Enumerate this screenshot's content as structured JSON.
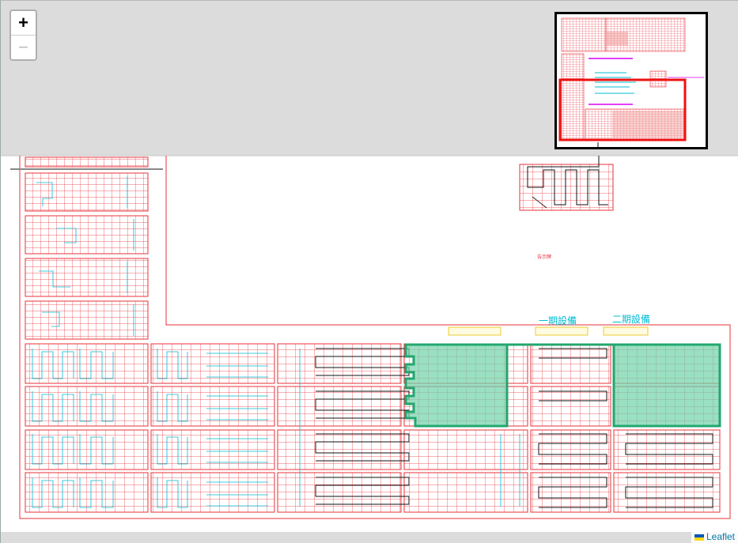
{
  "zoom": {
    "in_label": "+",
    "out_label": "−"
  },
  "attribution": {
    "label": "Leaflet"
  },
  "labels": {
    "phase1": "一期設備",
    "phase2": "二期設備",
    "small_note": "告示牌"
  },
  "colors": {
    "map_background": "#dcdcdc",
    "plan_background": "#ffffff",
    "grid_line": "#e8303a",
    "annotation": "#00bcd4",
    "wiring": "#111111",
    "highlight_fill": "#6fd3a9",
    "highlight_stroke": "#23a66f",
    "label_box": "#e6c000",
    "minimap_view": "#ee1111"
  }
}
